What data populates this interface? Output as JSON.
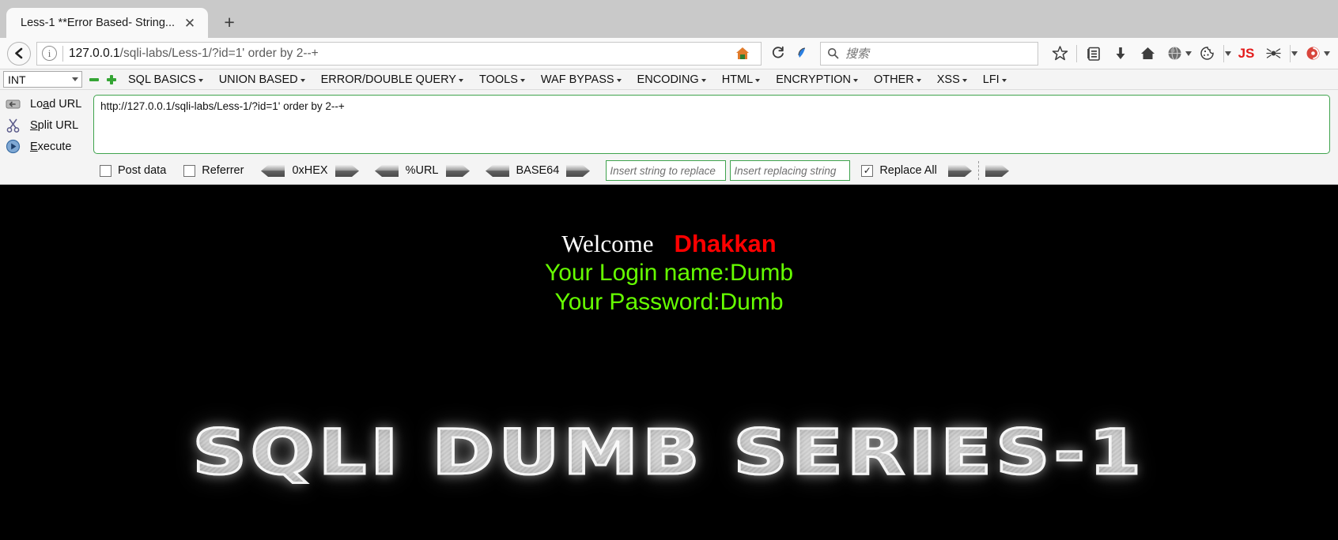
{
  "browser": {
    "tab": {
      "title": "Less-1 **Error Based- String...",
      "close_icon": "close-icon"
    },
    "new_tab_label": "+",
    "nav": {
      "back_icon": "back-arrow-icon",
      "info_icon": "page-info-icon",
      "url_host": "127.0.0.1",
      "url_path": "/sqli-labs/Less-1/?id=1' order by 2--+",
      "home_icon": "home-icon",
      "reload_icon": "reload-icon",
      "container_icon": "container-tab-icon"
    },
    "search": {
      "icon": "search-icon",
      "placeholder": "搜索"
    },
    "toolbar_icons": [
      {
        "name": "bookmark-star-icon"
      },
      {
        "name": "reader-list-icon"
      },
      {
        "name": "downloads-icon"
      },
      {
        "name": "home-button-icon"
      },
      {
        "name": "globe-menu-icon"
      },
      {
        "name": "cookie-manager-icon"
      },
      {
        "name": "overflow-menu-icon"
      },
      {
        "name": "javascript-toggle-icon",
        "label": "JS"
      },
      {
        "name": "spider-tool-icon"
      },
      {
        "name": "extension-menu-icon"
      },
      {
        "name": "account-menu-icon"
      }
    ]
  },
  "hackbar": {
    "type_select": {
      "value": "INT"
    },
    "minus_icon": "remove-icon",
    "plus_icon": "add-icon",
    "menus": [
      {
        "label": "SQL BASICS"
      },
      {
        "label": "UNION BASED"
      },
      {
        "label": "ERROR/DOUBLE QUERY"
      },
      {
        "label": "TOOLS"
      },
      {
        "label": "WAF BYPASS"
      },
      {
        "label": "ENCODING"
      },
      {
        "label": "HTML"
      },
      {
        "label": "ENCRYPTION"
      },
      {
        "label": "OTHER"
      },
      {
        "label": "XSS"
      },
      {
        "label": "LFI"
      }
    ],
    "actions": [
      {
        "label": "Load URL",
        "icon": "load-url-icon"
      },
      {
        "label": "Split URL",
        "icon": "split-url-icon"
      },
      {
        "label": "Execute",
        "icon": "execute-icon"
      }
    ],
    "request_text": "http://127.0.0.1/sqli-labs/Less-1/?id=1' order by 2--+",
    "options": {
      "post_data": {
        "label": "Post data",
        "checked": false
      },
      "referrer": {
        "label": "Referrer",
        "checked": false
      },
      "encoders": [
        {
          "label": "0xHEX"
        },
        {
          "label": "%URL"
        },
        {
          "label": "BASE64"
        }
      ],
      "replace_from_placeholder": "Insert string to replace",
      "replace_to_placeholder": "Insert replacing string",
      "replace_all": {
        "label": "Replace All",
        "checked": true
      }
    }
  },
  "page": {
    "welcome_word": "Welcome",
    "welcome_name": "Dhakkan",
    "login_line": "Your Login name:Dumb",
    "password_line": "Your Password:Dumb",
    "logo_text": "SQLI DUMB SERIES-1",
    "colors": {
      "welcome": "#ffffff",
      "name": "#ff0000",
      "credentials": "#66ff00",
      "background": "#000000"
    }
  }
}
